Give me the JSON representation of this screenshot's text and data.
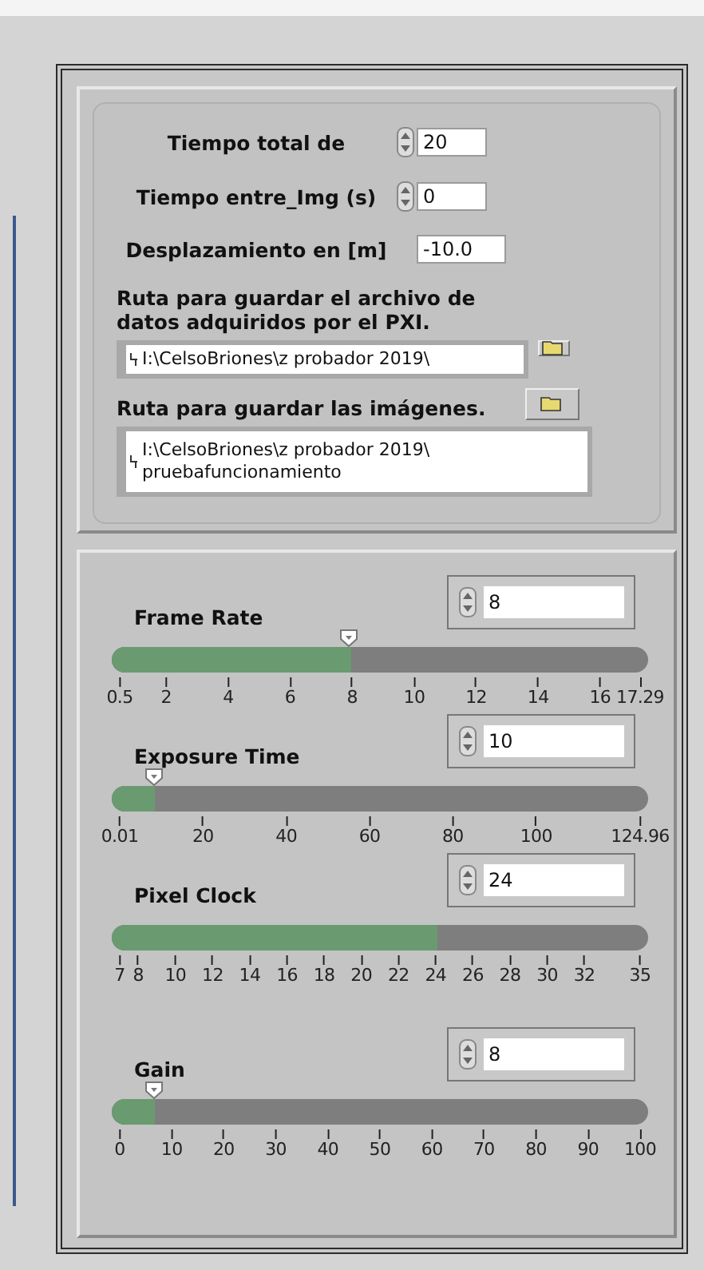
{
  "settings": {
    "numerics": [
      {
        "label": "Tiempo total de",
        "value": "20",
        "kind": "spinner"
      },
      {
        "label": "Tiempo entre_Img (s)",
        "value": "0",
        "kind": "spinner"
      },
      {
        "label": "Desplazamiento en [m]",
        "value": "-10.0",
        "kind": "plain"
      }
    ],
    "paths": [
      {
        "label": "Ruta para guardar el archivo de datos adquiridos por el PXI.",
        "lines": [
          "I:\\CelsoBriones\\z probador 2019\\"
        ],
        "kind": "below"
      },
      {
        "label": "Ruta para guardar las imágenes.",
        "lines": [
          "I:\\CelsoBriones\\z probador 2019\\",
          "pruebafuncionamiento"
        ],
        "kind": "beside"
      }
    ]
  },
  "camera": {
    "sliders": [
      {
        "label": "Frame Rate",
        "value": "8",
        "level": 0.447,
        "thumb": true,
        "ticks": [
          "0.5",
          "2",
          "4",
          "6",
          "8",
          "10",
          "12",
          "14",
          "16",
          "17.29"
        ]
      },
      {
        "label": "Exposure Time",
        "value": "10",
        "level": 0.08,
        "thumb": true,
        "ticks": [
          "0.01",
          "20",
          "40",
          "60",
          "80",
          "100",
          "124.96"
        ]
      },
      {
        "label": "Pixel Clock",
        "value": "24",
        "level": 0.607,
        "thumb": false,
        "ticks": [
          "7",
          "8",
          "10",
          "12",
          "14",
          "16",
          "18",
          "20",
          "22",
          "24",
          "26",
          "28",
          "30",
          "32",
          "35"
        ]
      },
      {
        "label": "Gain",
        "value": "8",
        "level": 0.08,
        "thumb": true,
        "ticks": [
          "0",
          "10",
          "20",
          "30",
          "40",
          "50",
          "60",
          "70",
          "80",
          "90",
          "100"
        ]
      }
    ]
  }
}
